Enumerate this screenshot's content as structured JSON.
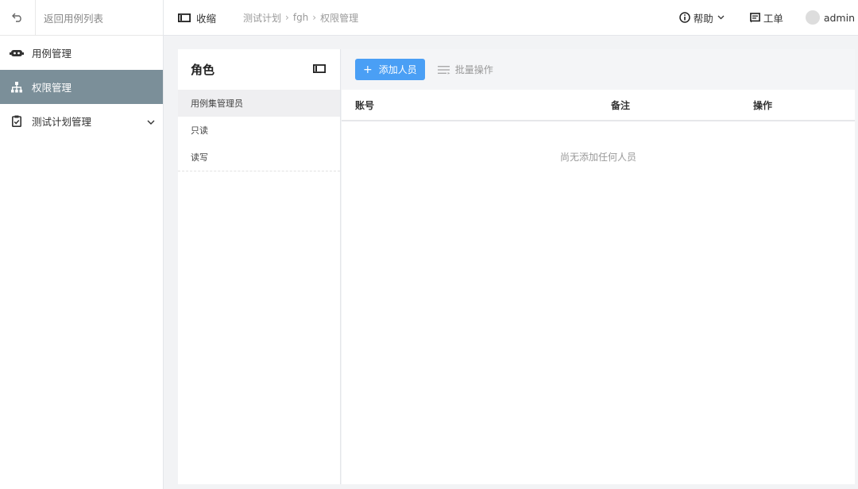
{
  "sidebar": {
    "back_label": "返回用例列表",
    "items": [
      {
        "label": "用例管理",
        "icon": "robot-icon",
        "active": false
      },
      {
        "label": "权限管理",
        "icon": "sitemap-icon",
        "active": true
      },
      {
        "label": "测试计划管理",
        "icon": "clipboard-check-icon",
        "active": false,
        "has_children": true
      }
    ]
  },
  "header": {
    "collapse_label": "收缩",
    "breadcrumb": [
      "测试计划",
      "fgh",
      "权限管理"
    ],
    "help_label": "帮助",
    "ticket_label": "工单",
    "user_name": "admin"
  },
  "roles": {
    "title": "角色",
    "items": [
      {
        "label": "用例集管理员",
        "active": true
      },
      {
        "label": "只读",
        "active": false
      },
      {
        "label": "读写",
        "active": false
      }
    ]
  },
  "main": {
    "add_button": "添加人员",
    "batch_label": "批量操作",
    "columns": [
      "账号",
      "备注",
      "操作"
    ],
    "empty_text": "尚无添加任何人员"
  },
  "colors": {
    "accent": "#4a9ff5",
    "sidebar_active": "#7b8f99"
  }
}
